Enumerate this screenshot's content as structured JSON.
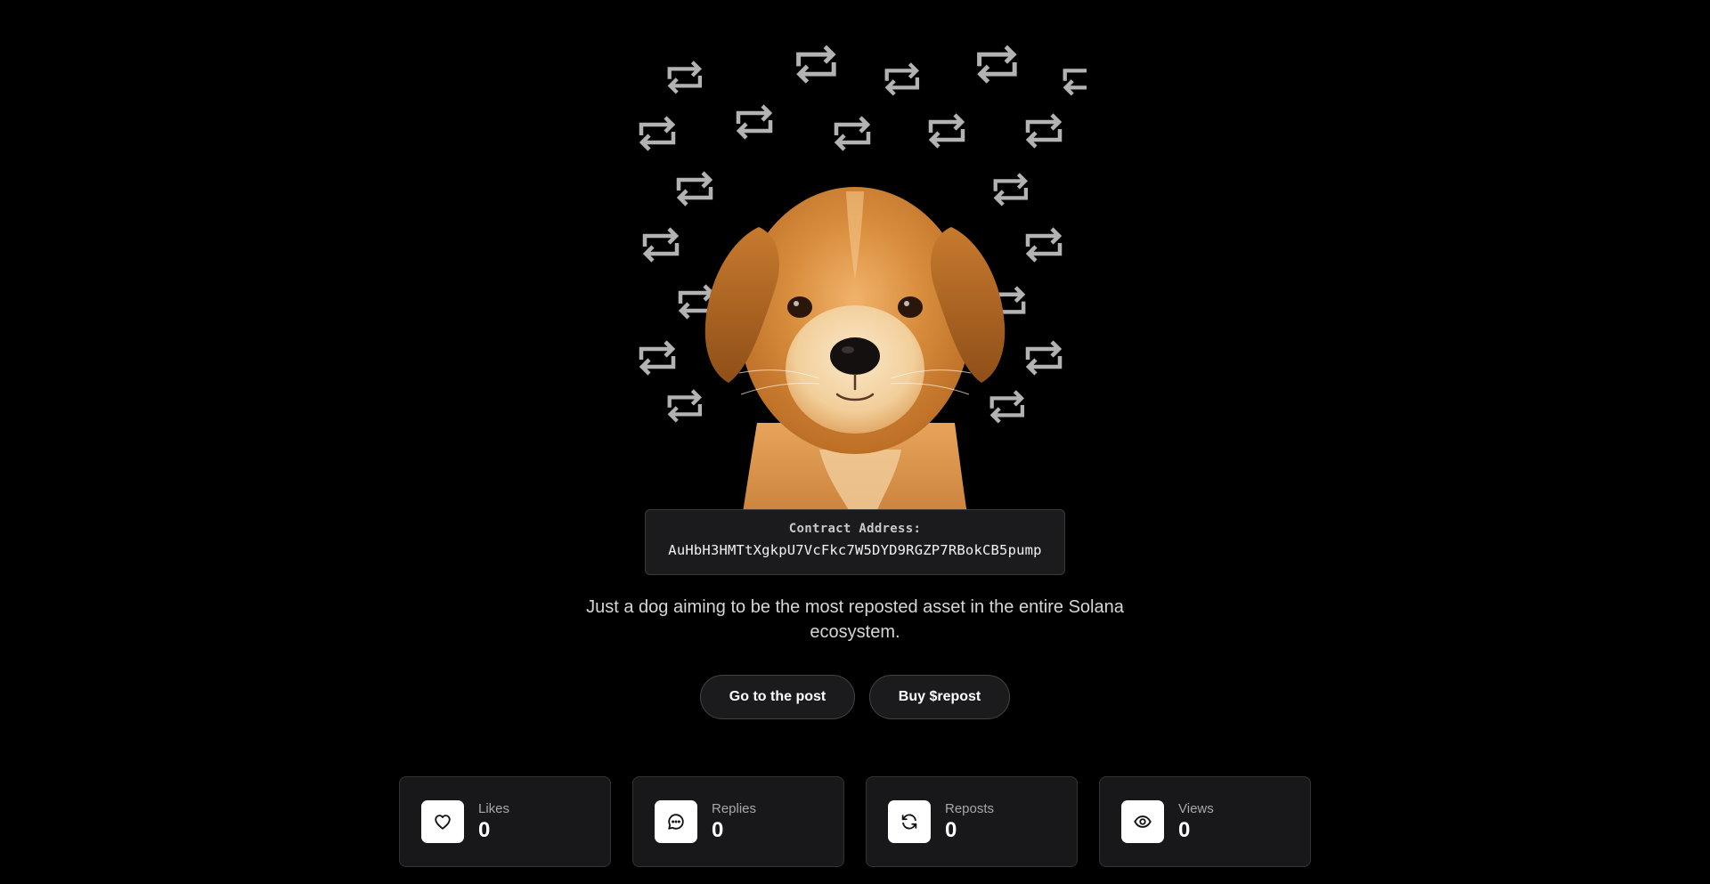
{
  "hero": {
    "image_alt": "puppy",
    "pattern_icon": "repost-icon"
  },
  "contract": {
    "label": "Contract Address:",
    "address": "AuHbH3HMTtXgkpU7VcFkc7W5DYD9RGZP7RBokCB5pump"
  },
  "tagline": "Just a dog aiming to be the most reposted asset in the entire Solana ecosystem.",
  "buttons": {
    "post": "Go to the post",
    "buy": "Buy $repost"
  },
  "stats": [
    {
      "label": "Likes",
      "value": "0",
      "icon": "heart-icon"
    },
    {
      "label": "Replies",
      "value": "0",
      "icon": "comment-icon"
    },
    {
      "label": "Reposts",
      "value": "0",
      "icon": "refresh-icon"
    },
    {
      "label": "Views",
      "value": "0",
      "icon": "eye-icon"
    }
  ],
  "colors": {
    "background": "#000000",
    "card": "#18181a",
    "pattern": "#b3b3b3"
  }
}
